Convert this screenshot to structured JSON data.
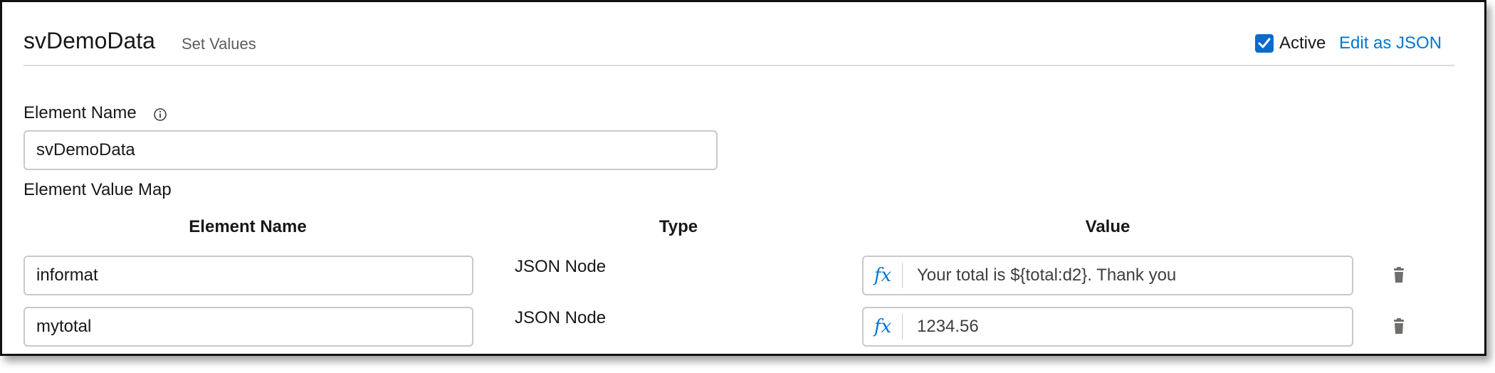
{
  "header": {
    "title": "svDemoData",
    "subtitle": "Set Values",
    "active_label": "Active",
    "active_checked": true,
    "edit_json_label": "Edit as JSON"
  },
  "element_name": {
    "label": "Element Name",
    "value": "svDemoData"
  },
  "value_map": {
    "label": "Element Value Map",
    "columns": {
      "element_name": "Element Name",
      "type": "Type",
      "value": "Value"
    },
    "rows": [
      {
        "element_name": "informat",
        "type": "JSON Node",
        "fx": "fx",
        "value": "Your total is ${total:d2}.  Thank you"
      },
      {
        "element_name": "mytotal",
        "type": "JSON Node",
        "fx": "fx",
        "value": "1234.56"
      }
    ]
  },
  "colors": {
    "accent": "#0176d3",
    "checkbox": "#0b6bcb",
    "border": "#c9c9c9"
  }
}
